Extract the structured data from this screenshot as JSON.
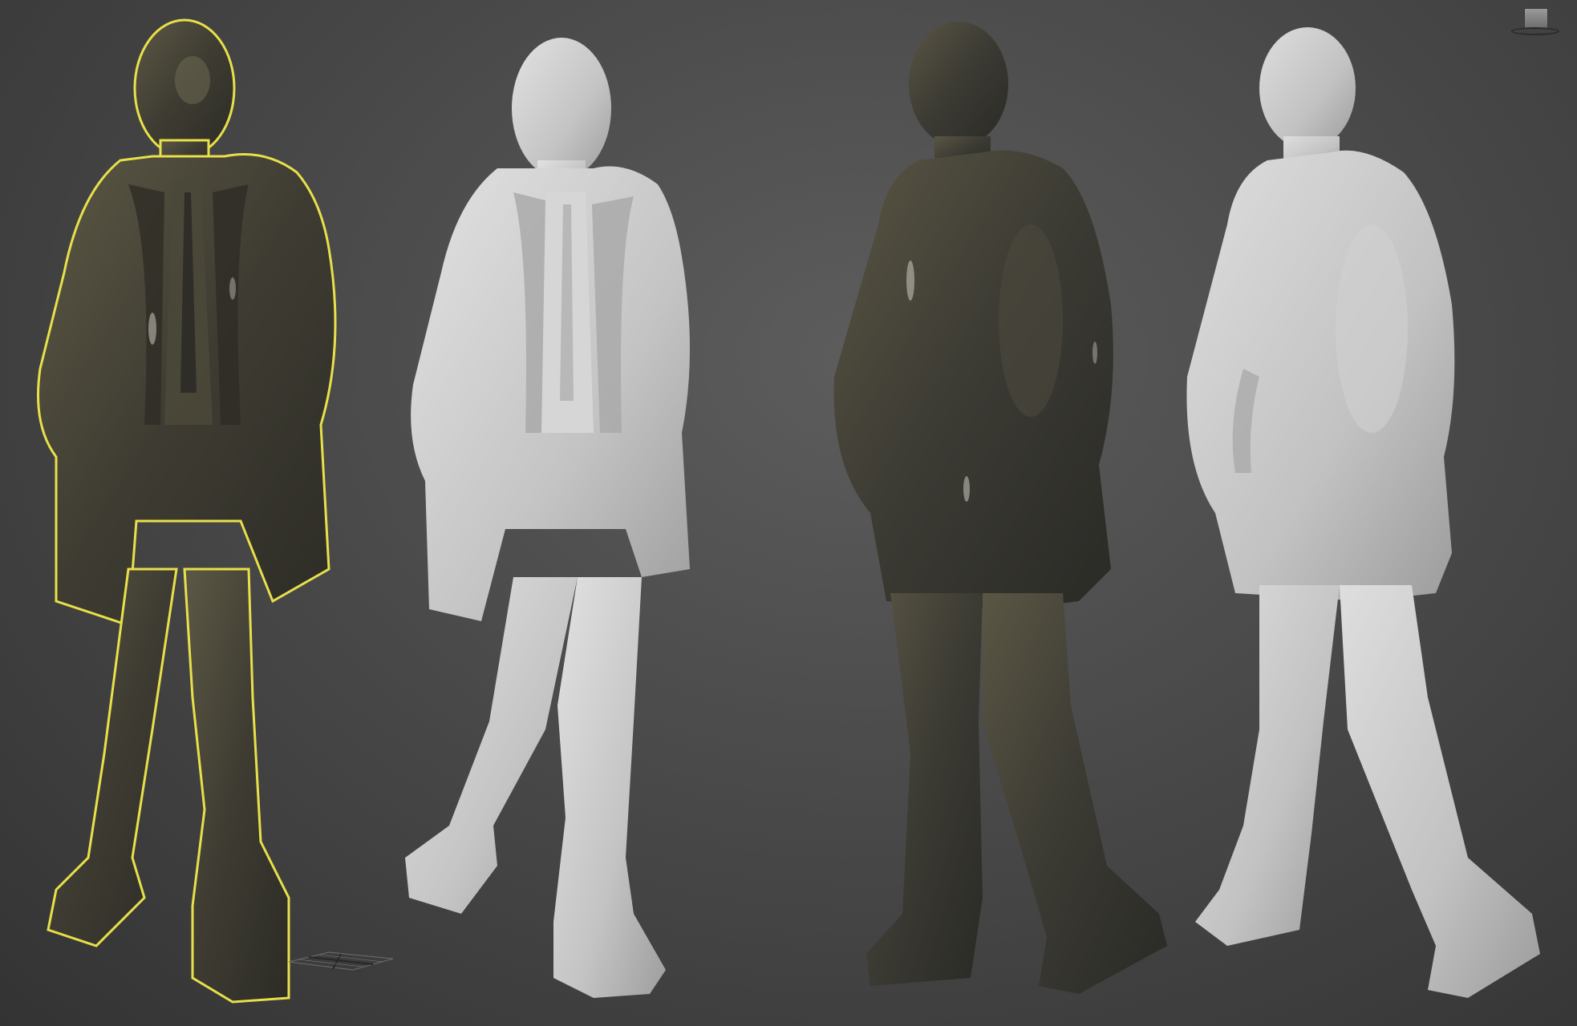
{
  "viewport": {
    "background_color": "#4a4a4a",
    "selection_color": "#e8e04a"
  },
  "viewcube": {
    "face_label": "",
    "icon": "viewcube-icon"
  },
  "figures": [
    {
      "name": "statue-front-bronze",
      "material": "bronze",
      "color": "#4d4a3d",
      "selected": true
    },
    {
      "name": "statue-front-clay",
      "material": "clay",
      "color": "#c8c8c8",
      "selected": false
    },
    {
      "name": "statue-back-bronze",
      "material": "bronze",
      "color": "#45443c",
      "selected": false
    },
    {
      "name": "statue-back-clay",
      "material": "clay",
      "color": "#c8c8c8",
      "selected": false
    }
  ],
  "gizmo": {
    "icon": "pivot-grid-icon"
  }
}
